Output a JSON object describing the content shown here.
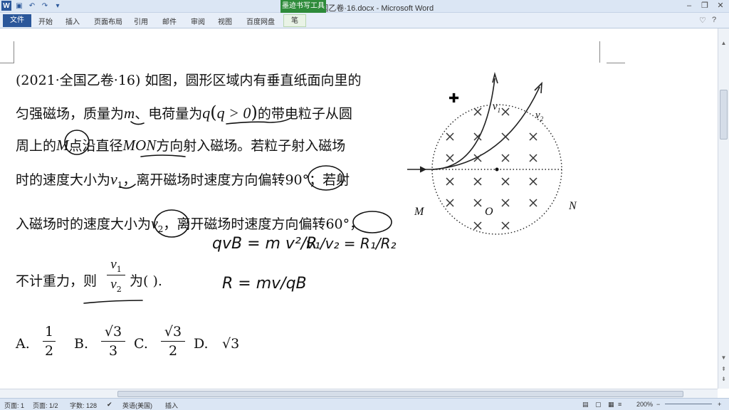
{
  "window": {
    "title": "2021全国乙卷·16.docx - Microsoft Word",
    "context_tab": "墨迹书写工具"
  },
  "ribbon": {
    "file": "文件",
    "tabs": [
      "开始",
      "插入",
      "页面布局",
      "引用",
      "邮件",
      "审阅",
      "视图",
      "百度网盘"
    ],
    "pen_tab": "笔"
  },
  "doc": {
    "line1": "(2021·全国乙卷·16)  如图，圆形区域内有垂直纸面向里的",
    "line2a": "匀强磁场，质量为",
    "line2m": "m",
    "line2b": "、电荷量为",
    "line2q": "q",
    "line2paren": "(",
    "line2cond": "q > 0",
    "line2paren2": ")",
    "line2c": "的带电粒子从圆",
    "line3a": "周上的",
    "line3M": "M",
    "line3b": "点沿直径",
    "line3MON": "MON",
    "line3c": "方向射入磁场。若粒子射入磁场",
    "line4a": "时的速度大小为",
    "line4v": "v",
    "line4sub": "1",
    "line4b": "，离开磁场时速度方向偏转",
    "line4deg": "90°",
    "line4c": "；若射",
    "line5a": "入磁场时的速度大小为",
    "line5v": "v",
    "line5sub": "2",
    "line5b": "，离开磁场时速度方向偏转",
    "line5deg": "60°",
    "line5c": "，",
    "line6a": "不计重力，则",
    "line6num": "v",
    "line6numsub": "1",
    "line6den": "v",
    "line6densub": "2",
    "line6b": "为(       ).",
    "optA": "A.",
    "optA_num": "1",
    "optA_den": "2",
    "optB": "B.",
    "optB_num": "√3",
    "optB_den": "3",
    "optC": "C.",
    "optC_num": "√3",
    "optC_den": "2",
    "optD": "D.",
    "optD_val": "√3"
  },
  "figure": {
    "label_v1": "v",
    "label_v1_sub": "1",
    "label_v2": "v",
    "label_v2_sub": "2",
    "label_M": "M",
    "label_O": "O",
    "label_N": "N"
  },
  "handwriting": {
    "eq1": "qvB = m v²/R",
    "eq2": "v₁/v₂ = R₁/R₂",
    "eq3": "R = mv/qB"
  },
  "status": {
    "page": "页面: 1",
    "pages": "页面: 1/2",
    "words": "字数: 128",
    "lang": "英语(美国)",
    "mode": "插入",
    "zoom": "200%"
  }
}
